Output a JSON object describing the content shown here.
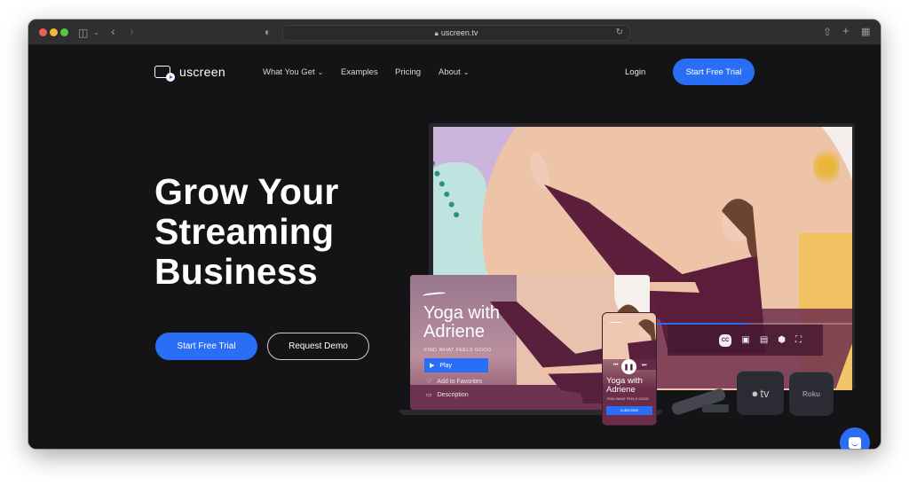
{
  "browser": {
    "url": "uscreen.tv",
    "icons": [
      "sidebar-icon",
      "chevron-down-icon",
      "back-icon",
      "forward-icon",
      "shield-icon",
      "lock-icon",
      "reload-icon",
      "share-icon",
      "new-tab-icon",
      "tab-overview-icon"
    ]
  },
  "header": {
    "logo_text": "uscreen",
    "nav": [
      {
        "label": "What You Get",
        "has_dropdown": true
      },
      {
        "label": "Examples",
        "has_dropdown": false
      },
      {
        "label": "Pricing",
        "has_dropdown": false
      },
      {
        "label": "About",
        "has_dropdown": true
      }
    ],
    "login_label": "Login",
    "cta_label": "Start Free Trial"
  },
  "hero": {
    "title_lines": [
      "Grow Your",
      "Streaming",
      "Business"
    ],
    "primary_cta": "Start Free Trial",
    "secondary_cta": "Request Demo"
  },
  "showcase": {
    "tv": {
      "player_controls": [
        "CC",
        "picture-in-picture",
        "cast",
        "settings",
        "fullscreen"
      ],
      "cc_label": "CC"
    },
    "laptop": {
      "title_line1": "Yoga with",
      "title_line2": "Adriene",
      "subtitle": "FIND WHAT FEELS GOOD",
      "play_label": "Play",
      "favorites_label": "Add to Favorites",
      "description_label": "Description"
    },
    "phone": {
      "title_line1": "Yoga with",
      "title_line2": "Adriene",
      "subtitle": "FIND WHAT FEELS GOOD",
      "button_label": "SUBSCRIBE"
    },
    "devices": {
      "appletv_label": "tv",
      "roku_label": "Roku"
    }
  },
  "colors": {
    "accent": "#2b6ef6",
    "background": "#141417",
    "titlebar": "#2f2f31"
  }
}
